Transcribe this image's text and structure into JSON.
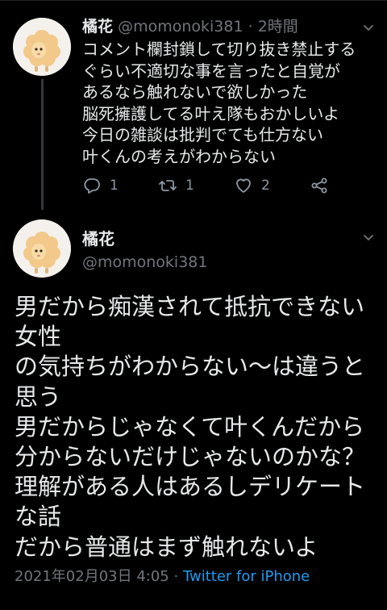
{
  "reply_tweet": {
    "name": "橘花",
    "handle": "@momonoki381",
    "separator": "·",
    "time": "2時間",
    "lines": [
      "コメント欄封鎖して切り抜き禁止する",
      "ぐらい不適切な事を言ったと自覚が",
      "あるなら触れないで欲しかった",
      "脳死擁護してる叶え隊もおかしいよ",
      "今日の雑談は批判でても仕方ない",
      "叶くんの考えがわからない"
    ],
    "replies": "1",
    "retweets": "1",
    "likes": "2"
  },
  "main_tweet": {
    "name": "橘花",
    "handle": "@momonoki381",
    "lines": [
      "男だから痴漢されて抵抗できない",
      "女性",
      "の気持ちがわからない〜は違うと",
      "思う",
      "男だからじゃなくて叶くんだから",
      "分からないだけじゃないのかな？",
      "理解がある人はあるしデリケート",
      "な話",
      "だから普通はまず触れないよ"
    ],
    "date": "2021年02月03日 4:05",
    "separator": "·",
    "source": "Twitter for iPhone"
  },
  "icons": {
    "avatar": "sheep-avatar",
    "caret": "chevron-down-icon",
    "reply": "reply-icon",
    "retweet": "retweet-icon",
    "like": "heart-icon",
    "share": "share-icon"
  },
  "colors": {
    "background": "#000000",
    "text": "#e7e9ea",
    "secondary": "#71767b",
    "link": "#1d9bf0"
  }
}
